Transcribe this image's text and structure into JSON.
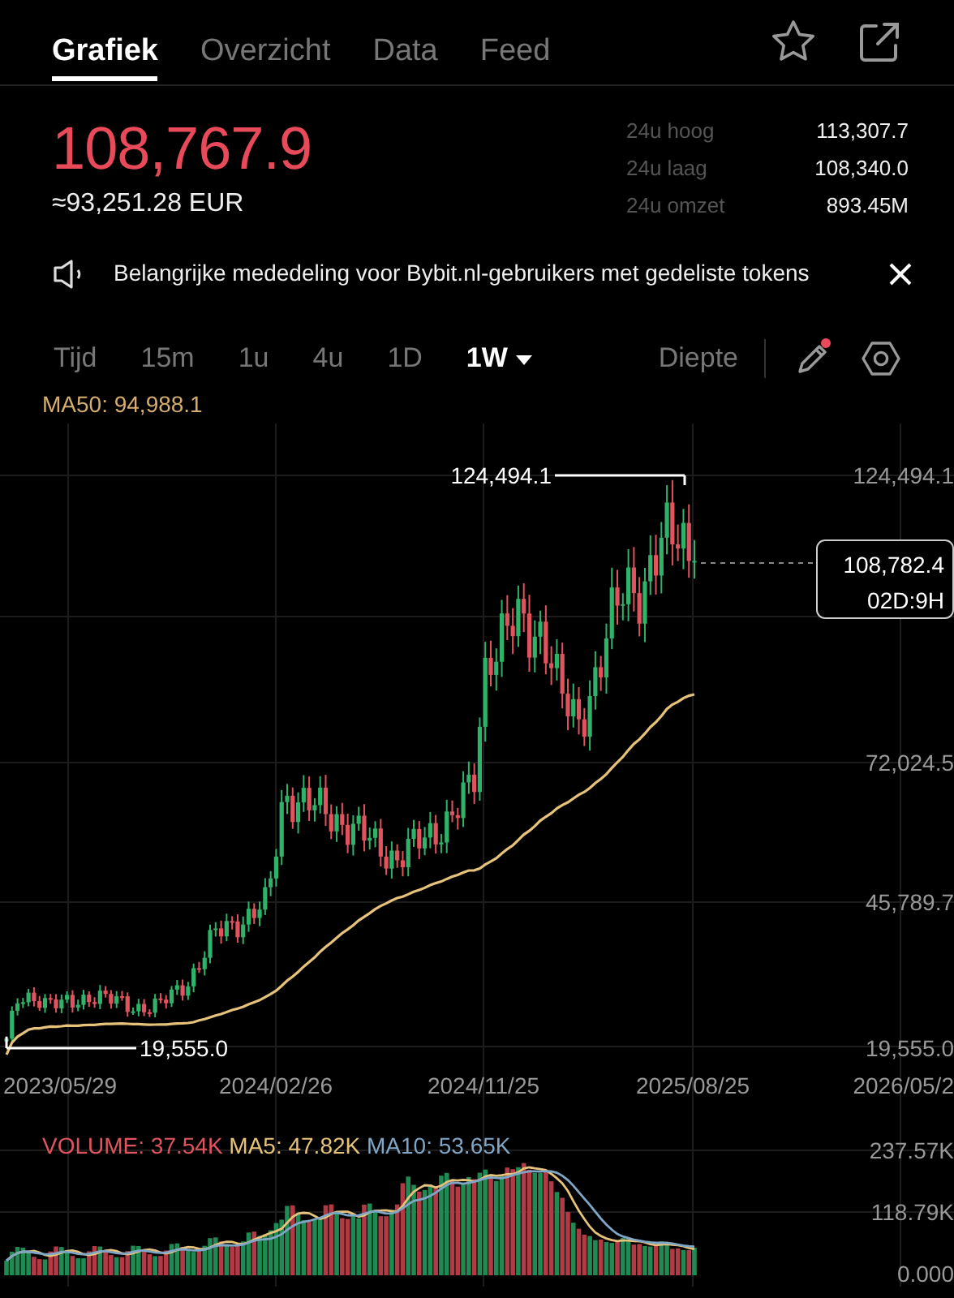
{
  "tabs": [
    {
      "label": "Grafiek",
      "selected": true
    },
    {
      "label": "Overzicht",
      "selected": false
    },
    {
      "label": "Data",
      "selected": false
    },
    {
      "label": "Feed",
      "selected": false
    }
  ],
  "price": {
    "last": "108,767.9",
    "fiat": "≈93,251.28 EUR"
  },
  "stats": [
    {
      "label": "24u hoog",
      "value": "113,307.7"
    },
    {
      "label": "24u laag",
      "value": "108,340.0"
    },
    {
      "label": "24u omzet",
      "value": "893.45M"
    }
  ],
  "announcement": {
    "text": "Belangrijke mededeling voor Bybit.nl-gebruikers met gedeliste tokens"
  },
  "timeframes": [
    {
      "label": "Tijd",
      "selected": false,
      "has_menu": false
    },
    {
      "label": "15m",
      "selected": false,
      "has_menu": false
    },
    {
      "label": "1u",
      "selected": false,
      "has_menu": false
    },
    {
      "label": "4u",
      "selected": false,
      "has_menu": false
    },
    {
      "label": "1D",
      "selected": false,
      "has_menu": false
    },
    {
      "label": "1W",
      "selected": true,
      "has_menu": true
    }
  ],
  "depth_button": "Diepte",
  "drawing_tool": {
    "notification": true
  },
  "chart": {
    "ma_legend": "MA50: 94,988.1",
    "high_label": "124,494.1",
    "low_label": "19,555.0",
    "y_labels": [
      "124,494.1",
      "72,024.5",
      "45,789.7",
      "19,555.0"
    ],
    "x_labels": [
      "2023/05/29",
      "2024/02/26",
      "2024/11/25",
      "2025/08/25",
      "2026/05/2"
    ],
    "price_tag": {
      "price": "108,782.4",
      "countdown": "02D:9H"
    }
  },
  "volume": {
    "legend": [
      {
        "text": "VOLUME: 37.54K",
        "color": "#e0535f"
      },
      {
        "text": "MA5: 47.82K",
        "color": "#e6c27a"
      },
      {
        "text": "MA10: 53.65K",
        "color": "#7fa6c6"
      }
    ],
    "y_labels": [
      "237.57K",
      "118.79K",
      "0.000"
    ]
  }
}
